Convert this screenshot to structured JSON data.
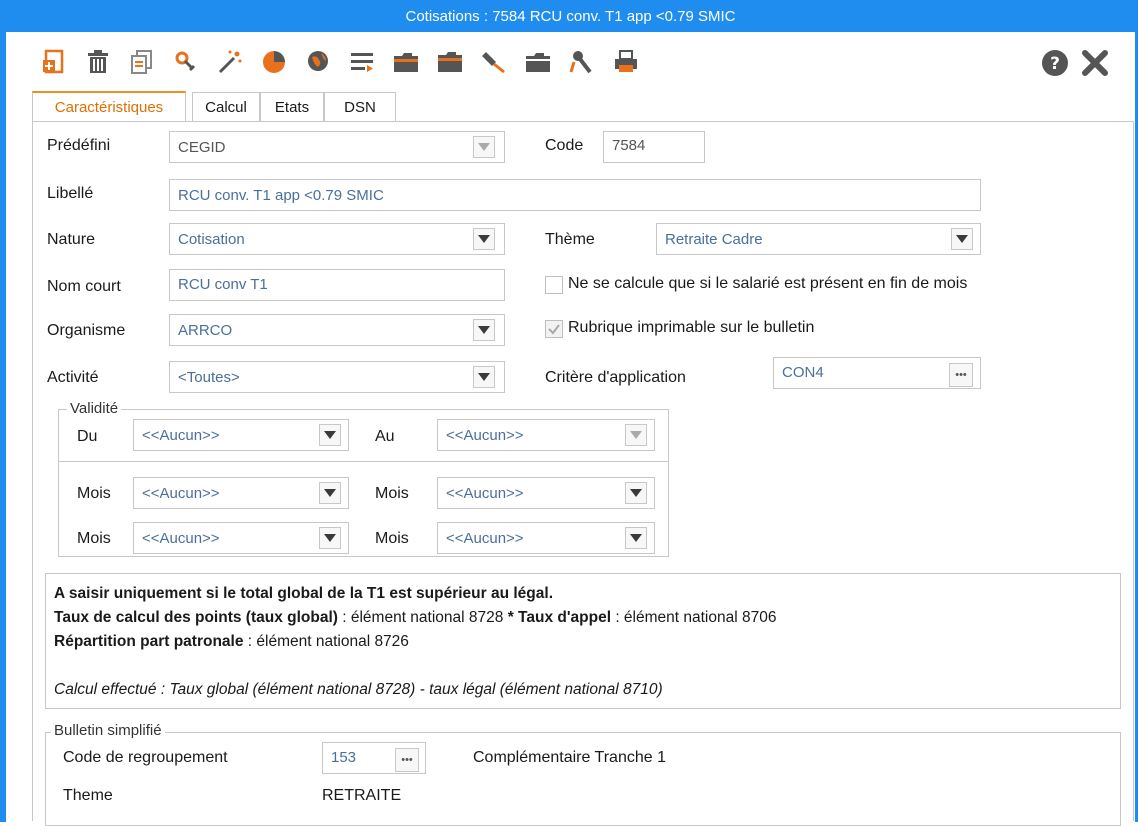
{
  "window": {
    "title": "Cotisations : 7584 RCU conv. T1 app <0.79 SMIC"
  },
  "toolbar": {
    "icons": [
      "new-icon",
      "delete-icon",
      "duplicate-icon",
      "link-icon",
      "wizard-icon",
      "chart-icon",
      "globe-icon",
      "list-icon",
      "folder-icon",
      "folder-open-icon",
      "pin-icon",
      "folder-closed-icon",
      "wrench-icon",
      "printer-icon"
    ],
    "help_glyph": "?",
    "close_glyph": "✕"
  },
  "tabs": [
    "Caractéristiques",
    "Calcul",
    "Etats",
    "DSN"
  ],
  "form": {
    "predefini_label": "Prédéfini",
    "predefini_value": "CEGID",
    "code_label": "Code",
    "code_value": "7584",
    "libelle_label": "Libellé",
    "libelle_value": "RCU conv. T1 app <0.79 SMIC",
    "nature_label": "Nature",
    "nature_value": "Cotisation",
    "theme_label": "Thème",
    "theme_value": "Retraite Cadre",
    "nomcourt_label": "Nom court",
    "nomcourt_value": "RCU conv T1",
    "calcule_label": "Ne se calcule que si le salarié est présent en fin de mois",
    "organisme_label": "Organisme",
    "organisme_value": "ARRCO",
    "imprimable_label": "Rubrique imprimable sur le bulletin",
    "activite_label": "Activité",
    "activite_value": "<Toutes>",
    "critere_label": "Critère d'application",
    "critere_value": "CON4"
  },
  "validite": {
    "title": "Validité",
    "du_label": "Du",
    "du_value": "<<Aucun>>",
    "au_label": "Au",
    "au_value": "<<Aucun>>",
    "mois_label": "Mois",
    "mois_values": [
      "<<Aucun>>",
      "<<Aucun>>",
      "<<Aucun>>",
      "<<Aucun>>"
    ]
  },
  "note": {
    "line1": "A saisir uniquement si le total global de la T1 est supérieur au légal.",
    "line2_b1": "Taux de calcul des points (taux global)",
    "line2_t1": " : élément national 8728 ",
    "line2_b2": "* Taux d'appel",
    "line2_t2": " : élément national 8706",
    "line3_b": "Répartition part patronale",
    "line3_t": " : élément national 8726",
    "line4": "Calcul effectué : Taux global (élément national 8728) - taux légal (élément national 8710)"
  },
  "bulletin": {
    "title": "Bulletin simplifié",
    "code_label": "Code de regroupement",
    "code_value": "153",
    "code_desc": "Complémentaire Tranche 1",
    "theme_label": "Theme",
    "theme_value": "RETRAITE"
  },
  "colors": {
    "accent": "#1f8df0",
    "active_tab": "#e07000",
    "toolbar_icon": "#e8711c"
  }
}
